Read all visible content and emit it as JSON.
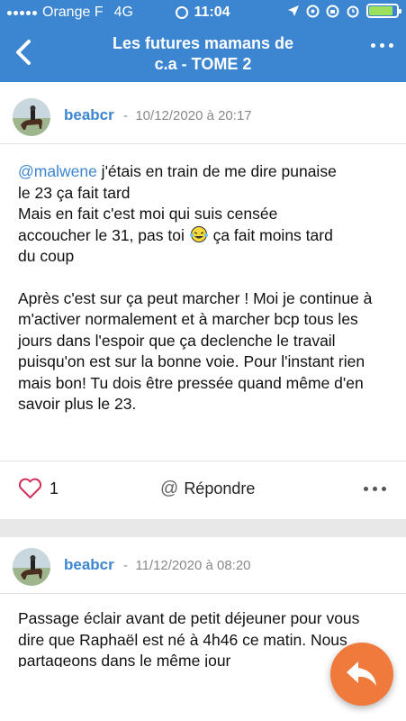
{
  "status_bar": {
    "carrier": "Orange F",
    "network": "4G",
    "time": "11:04"
  },
  "nav": {
    "title_line1": "Les futures mamans de",
    "title_line2": "c.a - TOME 2"
  },
  "posts": [
    {
      "author": "beabcr",
      "date": "10/12/2020 à 20:17",
      "mention": "@malwene",
      "line1_rest": " j'étais en train de me dire punaise",
      "line2": "le 23 ça fait tard",
      "line3": "Mais en fait c'est moi qui suis censée",
      "line4_a": "accoucher le 31, pas toi ",
      "line4_b": " ça fait moins tard",
      "line5": "du coup",
      "para2": "Après c'est sur ça peut marcher ! Moi je continue à m'activer normalement et à marcher bcp tous les jours dans l'espoir que ça declenche le travail puisqu'on est sur la bonne voie. Pour l'instant rien mais bon! Tu dois être pressée quand même d'en savoir plus le 23.",
      "likes": "1",
      "reply_label": "Répondre"
    },
    {
      "author": "beabcr",
      "date": "11/12/2020 à 08:20",
      "body": "Passage éclair avant de petit déjeuner pour vous dire que Raphaël est né à 4h46 ce matin. Nous partageons dans le même jour"
    }
  ],
  "icons": {
    "back": "chevron-left-icon",
    "more": "more-icon",
    "like": "heart-icon",
    "reply": "at-icon",
    "fab": "reply-arrow-icon"
  },
  "colors": {
    "header": "#3c85d0",
    "accent": "#3c85d0",
    "fab": "#f07a3c",
    "like": "#d0305a"
  }
}
